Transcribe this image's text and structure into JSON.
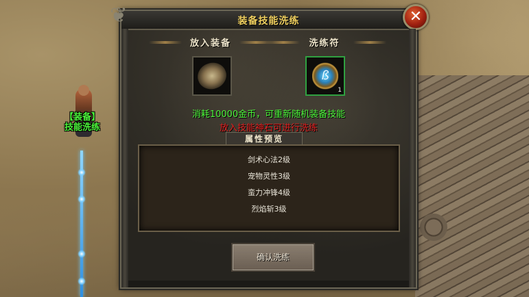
{
  "dialog": {
    "title": "装备技能洗练",
    "close_label": "✕",
    "equip_slot_label": "放入装备",
    "rune_slot_label": "洗练符",
    "rune_count": "1",
    "info_cost": "消耗10000金币，可重新随机装备技能",
    "info_hint": "放入技能神石可进行洗练",
    "preview_label": "属性预览",
    "attributes": [
      "剑术心法2级",
      "宠物灵性3级",
      "蛮力冲锋4级",
      "烈焰斩3级"
    ],
    "confirm_label": "确认洗练"
  },
  "npc": {
    "label_line1": "【装备】",
    "label_line2": "技能洗练"
  },
  "colors": {
    "title": "#f0d060",
    "info_green": "#4cf43a",
    "info_red": "#e02020",
    "rune_slot_border": "#2fa040"
  }
}
